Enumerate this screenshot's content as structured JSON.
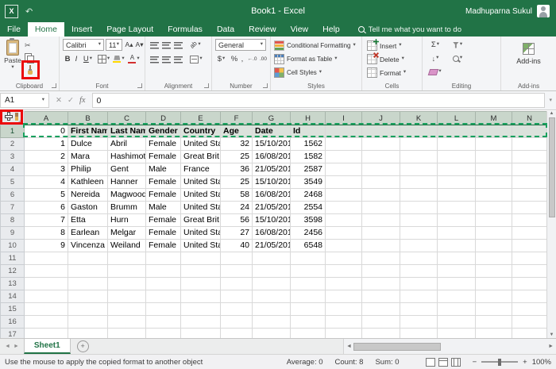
{
  "colors": {
    "excel_green": "#217346",
    "highlight_red": "#eb0c0c",
    "marching_ants_green": "#18a05e",
    "selection_fill": "#dbe2dc",
    "selected_header_fill": "#c9d6cb"
  },
  "title_bar": {
    "app_icon": "X",
    "title": "Book1 - Excel",
    "user_name": "Madhuparna Sukul"
  },
  "menu": {
    "tabs": [
      {
        "label": "File",
        "active": false
      },
      {
        "label": "Home",
        "active": true
      },
      {
        "label": "Insert",
        "active": false
      },
      {
        "label": "Page Layout",
        "active": false
      },
      {
        "label": "Formulas",
        "active": false
      },
      {
        "label": "Data",
        "active": false
      },
      {
        "label": "Review",
        "active": false
      },
      {
        "label": "View",
        "active": false
      },
      {
        "label": "Help",
        "active": false
      }
    ],
    "tell_me": "Tell me what you want to do"
  },
  "ribbon": {
    "clipboard": {
      "label": "Clipboard",
      "paste": "Paste"
    },
    "font": {
      "label": "Font",
      "name": "Calibri",
      "size": "11",
      "bold": "B",
      "italic": "I",
      "underline": "U",
      "grow": "A▴",
      "shrink": "A▾"
    },
    "alignment": {
      "label": "Alignment",
      "orientation": "ab"
    },
    "number": {
      "label": "Number",
      "format": "General",
      "currency": "$",
      "percent": "%",
      "comma": ",",
      "inc_decimal": "←.0",
      "dec_decimal": ".00"
    },
    "styles": {
      "label": "Styles",
      "items": [
        "Conditional Formatting",
        "Format as Table",
        "Cell Styles"
      ]
    },
    "cells": {
      "label": "Cells",
      "items": [
        "Insert",
        "Delete",
        "Format"
      ]
    },
    "editing": {
      "label": "Editing",
      "autosum": "Σ"
    },
    "addins": {
      "label": "Add-ins",
      "button": "Add-ins"
    }
  },
  "formula_bar": {
    "name_box": "A1",
    "cancel": "✕",
    "enter": "✓",
    "fx": "fx",
    "value": "0"
  },
  "sheet": {
    "columns": [
      "A",
      "B",
      "C",
      "D",
      "E",
      "F",
      "G",
      "H",
      "I",
      "J",
      "K",
      "L",
      "M",
      "N"
    ],
    "visible_rows": 18,
    "selected_row": 1,
    "active_cell": "A1",
    "col_align": [
      "r",
      "l",
      "l",
      "l",
      "l",
      "r",
      "l",
      "r",
      "l",
      "l",
      "l",
      "l",
      "l",
      "l"
    ],
    "grid_rows": [
      [
        "0",
        "First Nam",
        "Last Name",
        "Gender",
        "Country",
        "Age",
        "Date",
        "Id"
      ],
      [
        "1",
        "Dulce",
        "Abril",
        "Female",
        "United Sta",
        "32",
        "15/10/201",
        "1562"
      ],
      [
        "2",
        "Mara",
        "Hashimoto",
        "Female",
        "Great Brit",
        "25",
        "16/08/201",
        "1582"
      ],
      [
        "3",
        "Philip",
        "Gent",
        "Male",
        "France",
        "36",
        "21/05/201",
        "2587"
      ],
      [
        "4",
        "Kathleen",
        "Hanner",
        "Female",
        "United Sta",
        "25",
        "15/10/201",
        "3549"
      ],
      [
        "5",
        "Nereida",
        "Magwood",
        "Female",
        "United Sta",
        "58",
        "16/08/201",
        "2468"
      ],
      [
        "6",
        "Gaston",
        "Brumm",
        "Male",
        "United Sta",
        "24",
        "21/05/201",
        "2554"
      ],
      [
        "7",
        "Etta",
        "Hurn",
        "Female",
        "Great Brit",
        "56",
        "15/10/201",
        "3598"
      ],
      [
        "8",
        "Earlean",
        "Melgar",
        "Female",
        "United Sta",
        "27",
        "16/08/201",
        "2456"
      ],
      [
        "9",
        "Vincenza",
        "Weiland",
        "Female",
        "United Sta",
        "40",
        "21/05/201",
        "6548"
      ]
    ]
  },
  "sheet_tabs": {
    "active_tab": "Sheet1"
  },
  "status_bar": {
    "message": "Use the mouse to apply the copied format to another object",
    "average": "Average: 0",
    "count": "Count: 8",
    "sum": "Sum: 0",
    "zoom": "100%"
  },
  "icons": {
    "dropdown": "▾",
    "scissors": "✂",
    "up": "▲",
    "down": "▼",
    "left": "◄",
    "right": "►",
    "plus": "+",
    "minus": "−",
    "undo": "↶",
    "fill_down": "↓"
  }
}
